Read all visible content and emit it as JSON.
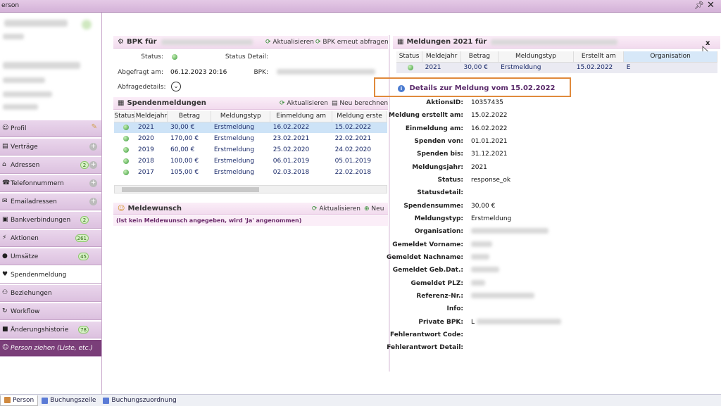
{
  "window": {
    "title": "erson",
    "pin_icon": "pin-icon",
    "close_label": "✕"
  },
  "nav": {
    "items": [
      {
        "label": "Profil",
        "icon": "person-icon"
      },
      {
        "label": "Verträge",
        "icon": "contract-icon"
      },
      {
        "label": "Adressen",
        "icon": "address-icon",
        "badge": "2"
      },
      {
        "label": "Telefonnummern",
        "icon": "phone-icon"
      },
      {
        "label": "Emailadressen",
        "icon": "email-icon"
      },
      {
        "label": "Bankverbindungen",
        "icon": "bank-icon",
        "badge": "2"
      },
      {
        "label": "Aktionen",
        "icon": "action-icon",
        "badge": "261"
      },
      {
        "label": "Umsätze",
        "icon": "sales-icon",
        "badge": "45"
      },
      {
        "label": "Spendenmeldung",
        "icon": "donation-icon"
      },
      {
        "label": "Beziehungen",
        "icon": "relation-icon"
      },
      {
        "label": "Workflow",
        "icon": "workflow-icon"
      },
      {
        "label": "Änderungshistorie",
        "icon": "history-icon",
        "badge": "78"
      },
      {
        "label": "Person ziehen (Liste, etc.)",
        "icon": "drag-person-icon"
      }
    ]
  },
  "bpk": {
    "title": "BPK für",
    "refresh": "Aktualisieren",
    "requery": "BPK erneut abfragen",
    "status_label": "Status:",
    "status_detail_label": "Status Detail:",
    "queried_label": "Abgefragt am:",
    "queried_value": "06.12.2023 20:16",
    "bpk_label": "BPK:",
    "details_label": "Abfragedetails:"
  },
  "spenden": {
    "title": "Spendenmeldungen",
    "refresh": "Aktualisieren",
    "recalc": "Neu berechnen",
    "columns": [
      "Status",
      "Meldejahr",
      "Betrag",
      "Meldungstyp",
      "Einmeldung am",
      "Meldung erste"
    ],
    "rows": [
      {
        "year": "2021",
        "amount": "30,00 €",
        "type": "Erstmeldung",
        "in": "16.02.2022",
        "created": "15.02.2022"
      },
      {
        "year": "2020",
        "amount": "170,00 €",
        "type": "Erstmeldung",
        "in": "23.02.2021",
        "created": "22.02.2021"
      },
      {
        "year": "2019",
        "amount": "60,00 €",
        "type": "Erstmeldung",
        "in": "25.02.2020",
        "created": "24.02.2020"
      },
      {
        "year": "2018",
        "amount": "100,00 €",
        "type": "Erstmeldung",
        "in": "06.01.2019",
        "created": "05.01.2019"
      },
      {
        "year": "2017",
        "amount": "105,00 €",
        "type": "Erstmeldung",
        "in": "02.03.2018",
        "created": "22.02.2018"
      }
    ]
  },
  "meldewunsch": {
    "title": "Meldewunsch",
    "refresh": "Aktualisieren",
    "new": "Neu",
    "note": "(Ist kein Meldewunsch angegeben, wird 'Ja' angenommen)"
  },
  "meldungen": {
    "title": "Meldungen 2021 für",
    "close": "x",
    "columns": [
      "Status",
      "Meldejahr",
      "Betrag",
      "Meldungstyp",
      "Erstellt am",
      "Organisation"
    ],
    "row": {
      "year": "2021",
      "amount": "30,00 €",
      "type": "Erstmeldung",
      "created": "15.02.2022",
      "org": "E"
    }
  },
  "details": {
    "title": "Details zur Meldung vom 15.02.2022",
    "fields": [
      {
        "label": "AktionsID:",
        "value": "10357435"
      },
      {
        "label": "Meldung erstellt am:",
        "value": "15.02.2022"
      },
      {
        "label": "Einmeldung am:",
        "value": "16.02.2022"
      },
      {
        "label": "Spenden von:",
        "value": "01.01.2021"
      },
      {
        "label": "Spenden bis:",
        "value": "31.12.2021"
      },
      {
        "label": "Meldungsjahr:",
        "value": "2021"
      },
      {
        "label": "Status:",
        "value": "response_ok"
      },
      {
        "label": "Statusdetail:",
        "value": ""
      },
      {
        "label": "Spendensumme:",
        "value": "30,00 €"
      },
      {
        "label": "Meldungstyp:",
        "value": "Erstmeldung"
      },
      {
        "label": "Organisation:",
        "value": ""
      },
      {
        "label": "Gemeldet Vorname:",
        "value": ""
      },
      {
        "label": "Gemeldet Nachname:",
        "value": ""
      },
      {
        "label": "Gemeldet Geb.Dat.:",
        "value": ""
      },
      {
        "label": "Gemeldet PLZ:",
        "value": ""
      },
      {
        "label": "Referenz-Nr.:",
        "value": ""
      },
      {
        "label": "Info:",
        "value": ""
      },
      {
        "label": "Private BPK:",
        "value": "L"
      },
      {
        "label": "Fehlerantwort Code:",
        "value": ""
      },
      {
        "label": "Fehlerantwort Detail:",
        "value": ""
      }
    ]
  },
  "tabs": [
    "Person",
    "Buchungszeile",
    "Buchungszuordnung"
  ]
}
